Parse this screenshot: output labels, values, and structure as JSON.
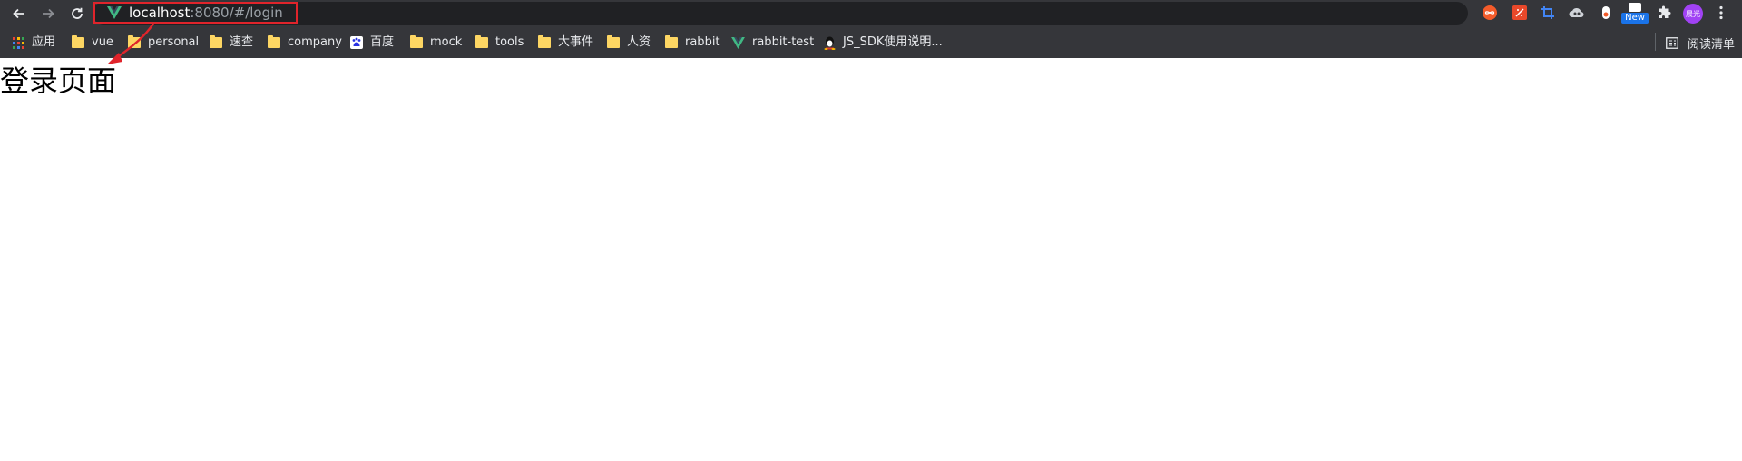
{
  "browser": {
    "url_host": "localhost",
    "url_rest": ":8080/#/login",
    "icons": [
      "back-icon",
      "forward-icon",
      "reload-icon",
      "vue-site-icon",
      "menu-icon"
    ],
    "extensions": [
      {
        "name": "infinity-extension-icon",
        "color": "#f35b2a"
      },
      {
        "name": "postman-extension-icon",
        "color": "#e8482a"
      },
      {
        "name": "crop-extension-icon",
        "color": "#4285f4"
      },
      {
        "name": "cloud-extension-icon",
        "color": "#cfd3d8"
      },
      {
        "name": "toggle-extension-icon",
        "color": "#ffffff"
      },
      {
        "name": "new-extension-icon",
        "badge": "New"
      },
      {
        "name": "puzzle-extension-icon",
        "color": "#e8eaed"
      }
    ],
    "avatar_text": "晨光",
    "avatar_color": "#a142f4",
    "highlight_color": "#e0242b"
  },
  "bookmarks": {
    "apps_label": "应用",
    "items": [
      {
        "label": "vue",
        "icon": "folder-icon"
      },
      {
        "label": "personal",
        "icon": "folder-icon"
      },
      {
        "label": "速查",
        "icon": "folder-icon"
      },
      {
        "label": "company",
        "icon": "folder-icon"
      },
      {
        "label": "百度",
        "icon": "baidu-icon"
      },
      {
        "label": "mock",
        "icon": "folder-icon"
      },
      {
        "label": "tools",
        "icon": "folder-icon"
      },
      {
        "label": "大事件",
        "icon": "folder-icon"
      },
      {
        "label": "人资",
        "icon": "folder-icon"
      },
      {
        "label": "rabbit",
        "icon": "folder-icon"
      },
      {
        "label": "rabbit-test",
        "icon": "vue-icon"
      },
      {
        "label": "JS_SDK使用说明...",
        "icon": "qq-icon"
      }
    ],
    "reading_list_label": "阅读清单"
  },
  "page": {
    "heading": "登录页面"
  }
}
